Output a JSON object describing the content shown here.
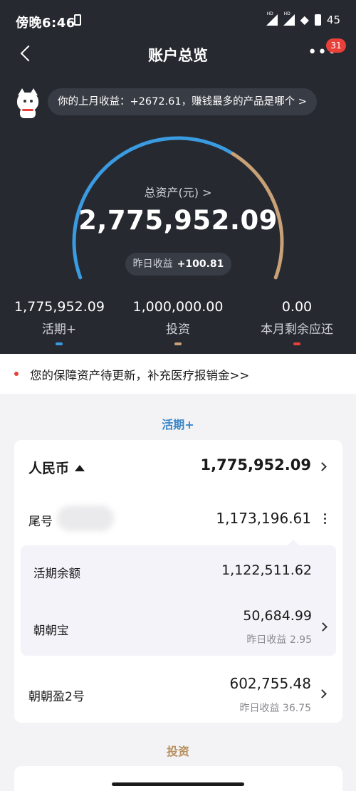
{
  "status_bar": {
    "time": "傍晚6:46",
    "vibrate_icon": "vibrate-icon",
    "signal_label": "HD",
    "battery": "45"
  },
  "nav": {
    "title": "账户总览",
    "badge_count": "31"
  },
  "tip": {
    "text": "你的上月收益：+2672.61，赚钱最多的产品是哪个 >"
  },
  "summary": {
    "total_label": "总资产(元) >",
    "total_value": "2,775,952.09",
    "yesterday_label": "昨日收益",
    "yesterday_value": "+100.81",
    "gauge_fraction": 0.64
  },
  "columns": [
    {
      "value": "1,775,952.09",
      "label": "活期+",
      "color": "#3a9be0"
    },
    {
      "value": "1,000,000.00",
      "label": "投资",
      "color": "#c9a177"
    },
    {
      "value": "0.00",
      "label": "本月剩余应还",
      "color": "#e9403a"
    }
  ],
  "notice": {
    "text": "您的保障资产待更新，补充医疗报销金>>"
  },
  "huoqi": {
    "title": "活期+",
    "currency_label": "人民币",
    "currency_total": "1,775,952.09",
    "account_label": "尾号",
    "account_value": "1,173,196.61",
    "sub": [
      {
        "label": "活期余额",
        "value": "1,122,511.62"
      },
      {
        "label": "朝朝宝",
        "value": "50,684.99",
        "note": "昨日收益 2.95"
      }
    ],
    "product": {
      "label": "朝朝盈2号",
      "value": "602,755.48",
      "note": "昨日收益 36.75"
    }
  },
  "invest": {
    "title": "投资"
  },
  "colors": {
    "dark_bg": "#262930",
    "gauge_blue": "#3a9be0",
    "gauge_gold": "#c9a177",
    "accent_red": "#e9403a"
  }
}
